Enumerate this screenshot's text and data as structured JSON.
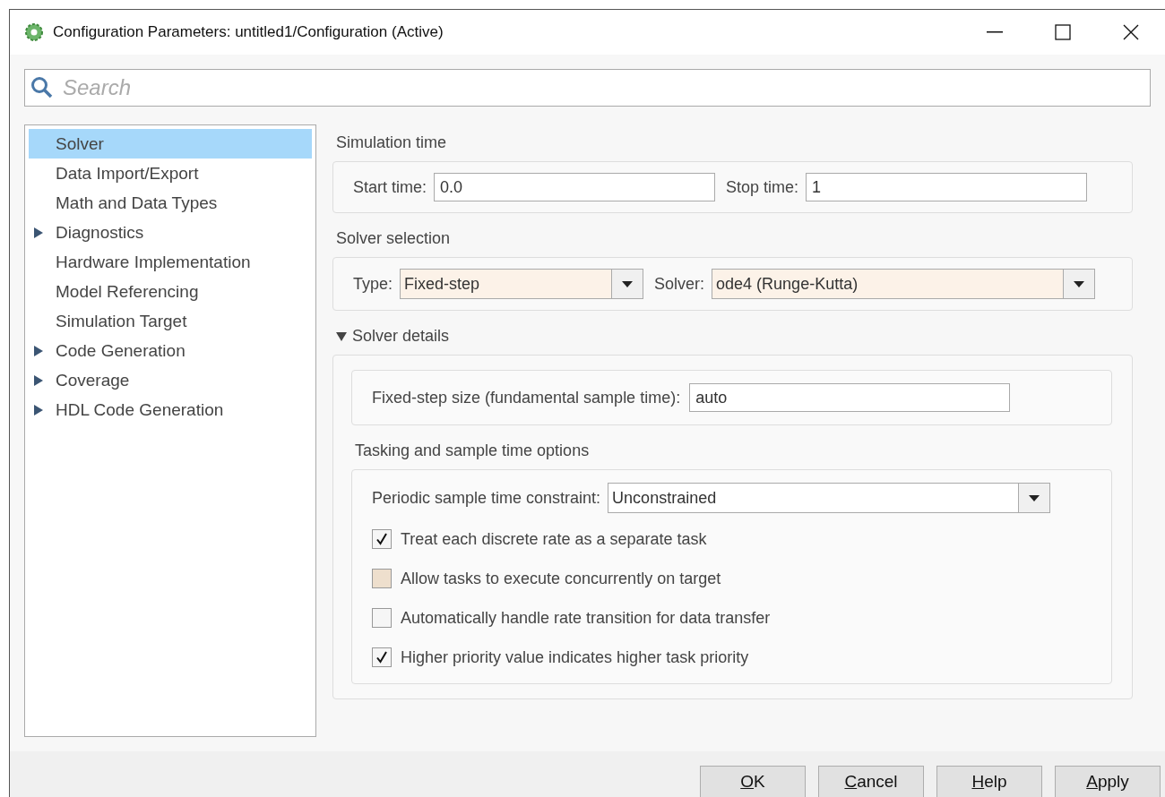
{
  "window": {
    "title": "Configuration Parameters: untitled1/Configuration (Active)"
  },
  "search": {
    "placeholder": "Search"
  },
  "tree": [
    {
      "label": "Solver",
      "kind": "page",
      "selected": true
    },
    {
      "label": "Data Import/Export",
      "kind": "page",
      "selected": false
    },
    {
      "label": "Math and Data Types",
      "kind": "page",
      "selected": false
    },
    {
      "label": "Diagnostics",
      "kind": "group",
      "expanded": false,
      "selected": false
    },
    {
      "label": "Hardware Implementation",
      "kind": "page",
      "selected": false
    },
    {
      "label": "Model Referencing",
      "kind": "page",
      "selected": false
    },
    {
      "label": "Simulation Target",
      "kind": "page",
      "selected": false
    },
    {
      "label": "Code Generation",
      "kind": "group",
      "expanded": false,
      "selected": false
    },
    {
      "label": "Coverage",
      "kind": "group",
      "expanded": false,
      "selected": false
    },
    {
      "label": "HDL Code Generation",
      "kind": "group",
      "expanded": false,
      "selected": false
    }
  ],
  "simulation_time": {
    "title": "Simulation time",
    "start_label": "Start time:",
    "start_value": "0.0",
    "stop_label": "Stop time:",
    "stop_value": "1"
  },
  "solver_selection": {
    "title": "Solver selection",
    "type_label": "Type:",
    "type_value": "Fixed-step",
    "type_modified": true,
    "solver_label": "Solver:",
    "solver_value": "ode4 (Runge-Kutta)",
    "solver_modified": true
  },
  "solver_details": {
    "title": "Solver details",
    "expanded": true,
    "step_label": "Fixed-step size (fundamental sample time):",
    "step_value": "auto",
    "tasking_title": "Tasking and sample time options",
    "constraint_label": "Periodic sample time constraint:",
    "constraint_value": "Unconstrained",
    "constraint_modified": false,
    "options": [
      {
        "label": "Treat each discrete rate as a separate task",
        "checked": true,
        "modified": false
      },
      {
        "label": "Allow tasks to execute concurrently on target",
        "checked": false,
        "modified": true
      },
      {
        "label": "Automatically handle rate transition for data transfer",
        "checked": false,
        "modified": false
      },
      {
        "label": "Higher priority value indicates higher task priority",
        "checked": true,
        "modified": false
      }
    ]
  },
  "buttons": [
    {
      "mnemonic": "O",
      "rest": "K"
    },
    {
      "mnemonic": "C",
      "rest": "ancel"
    },
    {
      "mnemonic": "H",
      "rest": "elp"
    },
    {
      "mnemonic": "A",
      "rest": "pply"
    }
  ]
}
